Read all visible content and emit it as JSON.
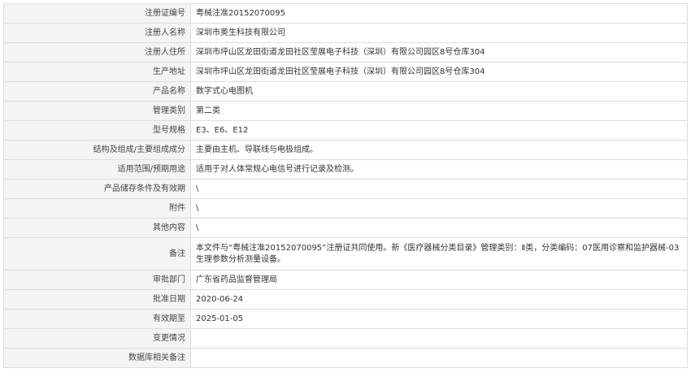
{
  "rows": [
    {
      "label": "注册证编号",
      "value": "粤械注准20152070095"
    },
    {
      "label": "注册人名称",
      "value": "深圳市奥生科技有限公司"
    },
    {
      "label": "注册人住所",
      "value": "深圳市坪山区龙田街道龙田社区莹展电子科技（深圳）有限公司园区8号仓库304"
    },
    {
      "label": "生产地址",
      "value": "深圳市坪山区龙田街道龙田社区莹展电子科技（深圳）有限公司园区8号仓库304"
    },
    {
      "label": "产品名称",
      "value": "数字式心电图机"
    },
    {
      "label": "管理类别",
      "value": "第二类"
    },
    {
      "label": "型号规格",
      "value": "E3、E6、E12"
    },
    {
      "label": "结构及组成/主要组成成分",
      "value": "主要由主机、导联线与电极组成。"
    },
    {
      "label": "适用范围/预期用途",
      "value": "适用于对人体常规心电信号进行记录及检测。"
    },
    {
      "label": "产品储存条件及有效期",
      "value": "\\"
    },
    {
      "label": "附件",
      "value": "\\"
    },
    {
      "label": "其他内容",
      "value": "\\"
    },
    {
      "label": "备注",
      "value": "本文件与“粤械注准20152070095”注册证共同使用。新《医疗器械分类目录》管理类别：Ⅱ类，分类编码：07医用诊察和监护器械-03生理参数分析测量设备。"
    },
    {
      "label": "审批部门",
      "value": "广东省药品监督管理局"
    },
    {
      "label": "批准日期",
      "value": "2020-06-24"
    },
    {
      "label": "有效期至",
      "value": "2025-01-05"
    },
    {
      "label": "变更情况",
      "value": ""
    },
    {
      "label": "数据库相关备注",
      "value": ""
    }
  ]
}
